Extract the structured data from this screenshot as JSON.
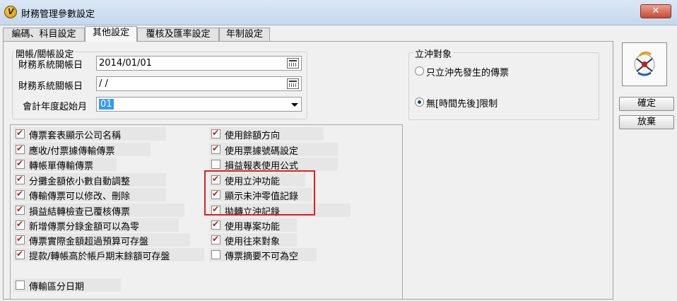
{
  "window": {
    "title": "財務管理參數設定",
    "close_label": "✕"
  },
  "tabs": [
    {
      "label": "編碼、科目設定",
      "active": false
    },
    {
      "label": "其他設定",
      "active": true
    },
    {
      "label": "覆核及匯率設定",
      "active": false
    },
    {
      "label": "年制設定",
      "active": false
    }
  ],
  "ledger_group": {
    "legend": "開帳/關帳設定",
    "open_date_label": "財務系統開帳日",
    "open_date_value": "2014/01/01",
    "close_date_label": "財務系統關帳日",
    "close_date_value": " / /",
    "fiscal_start_label": "會計年度起始月",
    "fiscal_start_value": "01"
  },
  "offset_group": {
    "legend": "立沖對象",
    "options": [
      {
        "label": "只立沖先發生的傳票",
        "selected": false
      },
      {
        "label": "無[時間先後]限制",
        "selected": true
      }
    ]
  },
  "options_left": [
    {
      "label": "傳票套表顯示公司名稱",
      "checked": true
    },
    {
      "label": "應收/付票據傳輸傳票",
      "checked": true
    },
    {
      "label": "轉帳單傳輸傳票",
      "checked": true
    },
    {
      "label": "分攤金額依小數自動調整",
      "checked": true
    },
    {
      "label": "傳輸傳票可以修改、刪除",
      "checked": true
    },
    {
      "label": "損益結轉檢查已覆核傳票",
      "checked": true
    },
    {
      "label": "新增傳票分錄金額可以為零",
      "checked": true
    },
    {
      "label": "傳票實際金額超過預算可存盤",
      "checked": true
    },
    {
      "label": "提款/轉帳高於帳戶期末餘額可存盤",
      "checked": true
    },
    {
      "label": "傳輸區分日期",
      "checked": false
    }
  ],
  "options_right": [
    {
      "label": "使用餘額方向",
      "checked": true
    },
    {
      "label": "使用票據號碼設定",
      "checked": true
    },
    {
      "label": "損益報表使用公式",
      "checked": false
    },
    {
      "label": "使用立沖功能",
      "checked": true
    },
    {
      "label": "顯示未沖零值記錄",
      "checked": true
    },
    {
      "label": "拋轉立沖記錄",
      "checked": true
    },
    {
      "label": "使用專案功能",
      "checked": true
    },
    {
      "label": "使用往來對象",
      "checked": true
    },
    {
      "label": "傳票摘要不可為空",
      "checked": false
    }
  ],
  "buttons": {
    "confirm": "確定",
    "cancel": "放棄"
  },
  "colors": {
    "highlight_box": "#e02020",
    "checkmark": "#b3261e",
    "selection": "#3399ff"
  }
}
